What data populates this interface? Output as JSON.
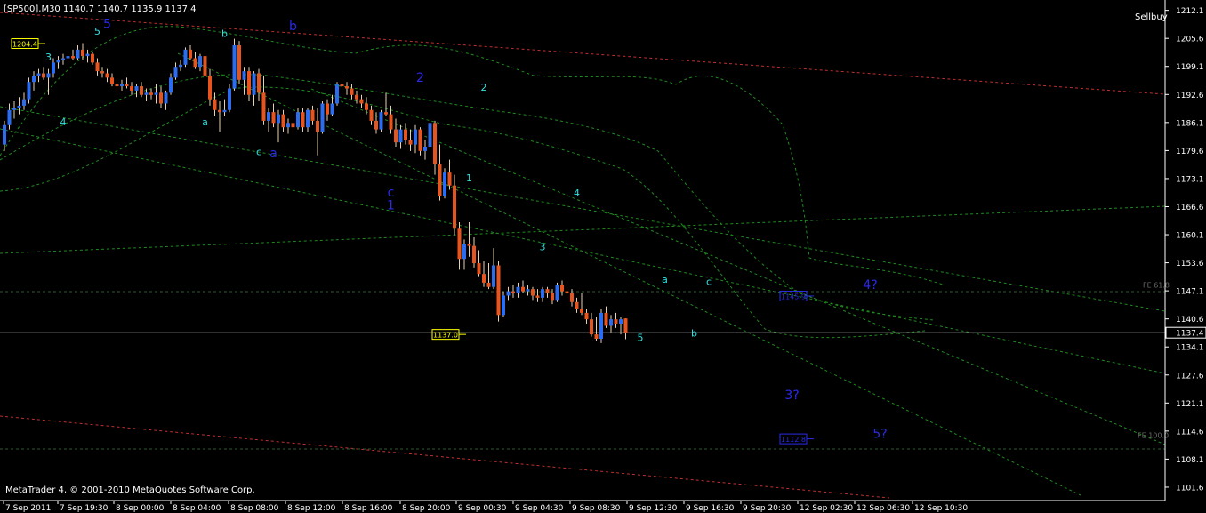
{
  "header": {
    "symbol_info": "[SP500],M30  1140.7 1140.7 1135.9 1137.4",
    "expert_name": "Sellbuy",
    "copyright": "MetaTrader 4, © 2001-2010 MetaQuotes Software Corp."
  },
  "colors": {
    "background": "#000000",
    "bull_candle": "#2b6cf0",
    "bear_candle": "#e8541e",
    "wick": "#e8d0b0",
    "bid_line": "#c8c8c8",
    "axis_text": "#ffffff",
    "indicator": "#1f8a1f",
    "channel_red": "#c03030",
    "wave_cyan": "#30e0e0",
    "wave_blue": "#2a2ae8",
    "price_tag": "#ffff00"
  },
  "chart_data": {
    "type": "candlestick",
    "symbol": "SP500",
    "timeframe": "M30",
    "ylim": [
      1098.5,
      1214.5
    ],
    "y_ticks": [
      "1212.1",
      "1205.6",
      "1199.1",
      "1192.6",
      "1186.1",
      "1179.6",
      "1173.1",
      "1166.6",
      "1160.1",
      "1153.6",
      "1147.1",
      "1140.6",
      "1134.1",
      "1127.6",
      "1121.1",
      "1114.6",
      "1108.1",
      "1101.6"
    ],
    "x_ticks": [
      "7 Sep 2011",
      "7 Sep 19:30",
      "8 Sep 00:00",
      "8 Sep 04:00",
      "8 Sep 08:00",
      "8 Sep 12:00",
      "8 Sep 16:00",
      "8 Sep 20:00",
      "9 Sep 00:30",
      "9 Sep 04:30",
      "9 Sep 08:30",
      "9 Sep 12:30",
      "9 Sep 16:30",
      "9 Sep 20:30",
      "12 Sep 02:30",
      "12 Sep 06:30",
      "12 Sep 10:30"
    ],
    "current_price": "1137.4",
    "tags": [
      {
        "label": "1204.4",
        "price": 1204.4,
        "bar": 4
      },
      {
        "label": "1137.0",
        "price": 1137.0,
        "bar": 90
      },
      {
        "label": "1145.9",
        "price": 1145.9,
        "bar": 152
      },
      {
        "label": "1112.8",
        "price": 1112.8,
        "bar": 152
      }
    ],
    "fe_levels": [
      {
        "label": "FE 61.8",
        "price": 1147.6
      },
      {
        "label": "FE 100.0",
        "price": 1112.8
      }
    ],
    "series": [
      {
        "name": "SP500",
        "ohlc": [
          [
            1181.0,
            1186.5,
            1179.5,
            1185.5
          ],
          [
            1185.5,
            1190.5,
            1184.5,
            1189.0
          ],
          [
            1189.0,
            1191.0,
            1187.0,
            1189.5
          ],
          [
            1189.5,
            1192.0,
            1188.0,
            1190.0
          ],
          [
            1190.0,
            1193.0,
            1189.0,
            1191.5
          ],
          [
            1191.5,
            1196.5,
            1190.5,
            1195.5
          ],
          [
            1195.5,
            1198.0,
            1193.5,
            1197.0
          ],
          [
            1197.0,
            1198.5,
            1195.5,
            1197.5
          ],
          [
            1197.5,
            1199.0,
            1196.0,
            1196.5
          ],
          [
            1196.5,
            1198.5,
            1192.5,
            1197.5
          ],
          [
            1197.5,
            1201.0,
            1196.5,
            1200.0
          ],
          [
            1200.0,
            1201.5,
            1198.5,
            1200.5
          ],
          [
            1200.5,
            1202.0,
            1199.5,
            1201.0
          ],
          [
            1201.0,
            1202.5,
            1200.0,
            1201.5
          ],
          [
            1201.5,
            1203.0,
            1200.5,
            1201.0
          ],
          [
            1201.0,
            1204.0,
            1200.5,
            1203.0
          ],
          [
            1203.0,
            1204.5,
            1200.5,
            1201.5
          ],
          [
            1201.5,
            1203.0,
            1200.0,
            1202.0
          ],
          [
            1202.0,
            1202.5,
            1199.5,
            1200.0
          ],
          [
            1200.0,
            1201.0,
            1197.0,
            1198.0
          ],
          [
            1198.0,
            1199.0,
            1196.5,
            1197.5
          ],
          [
            1197.5,
            1198.5,
            1195.5,
            1196.5
          ],
          [
            1196.5,
            1197.5,
            1194.5,
            1195.0
          ],
          [
            1195.0,
            1196.0,
            1193.0,
            1194.5
          ],
          [
            1194.5,
            1196.0,
            1193.5,
            1195.0
          ],
          [
            1195.0,
            1196.5,
            1194.0,
            1194.5
          ],
          [
            1194.5,
            1195.5,
            1192.5,
            1193.5
          ],
          [
            1193.5,
            1195.0,
            1192.0,
            1194.5
          ],
          [
            1194.5,
            1195.5,
            1192.0,
            1192.5
          ],
          [
            1192.5,
            1194.0,
            1191.0,
            1193.0
          ],
          [
            1193.0,
            1194.0,
            1191.5,
            1192.5
          ],
          [
            1192.5,
            1195.0,
            1190.5,
            1193.0
          ],
          [
            1193.0,
            1194.5,
            1189.5,
            1190.5
          ],
          [
            1190.5,
            1193.5,
            1189.0,
            1193.0
          ],
          [
            1193.0,
            1197.5,
            1192.5,
            1196.5
          ],
          [
            1196.5,
            1200.0,
            1196.0,
            1199.0
          ],
          [
            1199.0,
            1200.5,
            1198.0,
            1199.5
          ],
          [
            1199.5,
            1203.5,
            1199.0,
            1203.0
          ],
          [
            1203.0,
            1204.0,
            1200.5,
            1201.0
          ],
          [
            1201.0,
            1202.5,
            1198.5,
            1199.0
          ],
          [
            1199.0,
            1202.0,
            1198.0,
            1201.5
          ],
          [
            1201.5,
            1202.5,
            1196.5,
            1197.0
          ],
          [
            1197.0,
            1198.5,
            1190.0,
            1191.5
          ],
          [
            1191.5,
            1193.0,
            1187.5,
            1189.0
          ],
          [
            1189.0,
            1191.0,
            1184.0,
            1188.5
          ],
          [
            1188.5,
            1191.5,
            1187.5,
            1189.0
          ],
          [
            1189.0,
            1195.0,
            1188.5,
            1194.0
          ],
          [
            1194.0,
            1205.5,
            1193.5,
            1204.0
          ],
          [
            1204.0,
            1205.0,
            1195.0,
            1196.0
          ],
          [
            1196.0,
            1199.0,
            1192.5,
            1198.0
          ],
          [
            1198.0,
            1199.0,
            1191.0,
            1192.5
          ],
          [
            1192.5,
            1198.0,
            1190.0,
            1197.5
          ],
          [
            1197.5,
            1198.5,
            1191.0,
            1193.0
          ],
          [
            1193.0,
            1197.0,
            1185.5,
            1186.5
          ],
          [
            1186.5,
            1189.5,
            1184.0,
            1188.5
          ],
          [
            1188.5,
            1190.5,
            1185.0,
            1186.0
          ],
          [
            1186.0,
            1189.0,
            1181.5,
            1188.0
          ],
          [
            1188.0,
            1189.0,
            1184.0,
            1185.0
          ],
          [
            1185.0,
            1187.0,
            1183.5,
            1186.0
          ],
          [
            1186.0,
            1187.5,
            1184.0,
            1185.0
          ],
          [
            1185.0,
            1189.5,
            1184.5,
            1188.5
          ],
          [
            1188.5,
            1189.5,
            1184.0,
            1185.0
          ],
          [
            1185.0,
            1189.5,
            1184.0,
            1189.0
          ],
          [
            1189.0,
            1190.0,
            1185.5,
            1186.5
          ],
          [
            1186.5,
            1189.5,
            1178.5,
            1184.0
          ],
          [
            1184.0,
            1191.0,
            1183.5,
            1190.5
          ],
          [
            1190.5,
            1191.5,
            1186.5,
            1188.0
          ],
          [
            1188.0,
            1192.5,
            1187.5,
            1190.5
          ],
          [
            1190.5,
            1195.5,
            1190.0,
            1195.0
          ],
          [
            1195.0,
            1196.5,
            1193.5,
            1194.5
          ],
          [
            1194.5,
            1195.5,
            1192.5,
            1194.0
          ],
          [
            1194.0,
            1195.0,
            1191.5,
            1192.5
          ],
          [
            1192.5,
            1193.5,
            1190.5,
            1191.5
          ],
          [
            1191.5,
            1192.5,
            1189.5,
            1190.5
          ],
          [
            1190.5,
            1192.0,
            1188.0,
            1189.0
          ],
          [
            1189.0,
            1190.0,
            1185.5,
            1186.5
          ],
          [
            1186.5,
            1188.5,
            1183.5,
            1184.5
          ],
          [
            1184.5,
            1189.0,
            1184.0,
            1188.5
          ],
          [
            1188.5,
            1193.0,
            1187.5,
            1188.0
          ],
          [
            1188.0,
            1190.0,
            1183.5,
            1184.5
          ],
          [
            1184.5,
            1187.0,
            1180.5,
            1181.5
          ],
          [
            1181.5,
            1185.5,
            1180.0,
            1184.5
          ],
          [
            1184.5,
            1186.0,
            1181.0,
            1182.0
          ],
          [
            1182.0,
            1184.5,
            1179.5,
            1181.0
          ],
          [
            1181.0,
            1185.5,
            1179.0,
            1184.5
          ],
          [
            1184.5,
            1185.0,
            1178.5,
            1179.5
          ],
          [
            1179.5,
            1182.0,
            1177.5,
            1180.5
          ],
          [
            1180.5,
            1187.0,
            1180.0,
            1186.0
          ],
          [
            1186.0,
            1186.5,
            1174.0,
            1176.5
          ],
          [
            1176.5,
            1181.0,
            1168.0,
            1169.0
          ],
          [
            1169.0,
            1175.5,
            1168.5,
            1174.5
          ],
          [
            1174.5,
            1177.5,
            1170.5,
            1171.5
          ],
          [
            1171.5,
            1174.0,
            1160.0,
            1161.5
          ],
          [
            1161.5,
            1163.0,
            1152.0,
            1154.5
          ],
          [
            1154.5,
            1159.0,
            1152.0,
            1158.0
          ],
          [
            1158.0,
            1163.0,
            1155.0,
            1157.5
          ],
          [
            1157.5,
            1159.5,
            1152.5,
            1153.5
          ],
          [
            1153.5,
            1156.5,
            1150.5,
            1151.0
          ],
          [
            1151.0,
            1154.0,
            1148.0,
            1149.0
          ],
          [
            1149.0,
            1153.5,
            1147.5,
            1148.0
          ],
          [
            1148.0,
            1157.0,
            1147.5,
            1153.0
          ],
          [
            1153.0,
            1154.0,
            1140.0,
            1141.5
          ],
          [
            1141.5,
            1147.0,
            1141.0,
            1146.0
          ],
          [
            1146.0,
            1148.0,
            1145.0,
            1147.0
          ],
          [
            1147.0,
            1148.5,
            1145.5,
            1146.5
          ],
          [
            1146.5,
            1149.0,
            1145.5,
            1148.0
          ],
          [
            1148.0,
            1149.5,
            1146.5,
            1147.0
          ],
          [
            1147.0,
            1148.5,
            1146.0,
            1147.5
          ],
          [
            1147.5,
            1148.0,
            1145.0,
            1146.0
          ],
          [
            1146.0,
            1147.5,
            1144.5,
            1145.5
          ],
          [
            1145.5,
            1148.0,
            1144.5,
            1147.5
          ],
          [
            1147.5,
            1148.0,
            1145.5,
            1146.5
          ],
          [
            1146.5,
            1147.5,
            1144.0,
            1145.0
          ],
          [
            1145.0,
            1149.0,
            1144.5,
            1148.5
          ],
          [
            1148.5,
            1149.5,
            1146.0,
            1147.0
          ],
          [
            1147.0,
            1148.0,
            1145.5,
            1146.5
          ],
          [
            1146.5,
            1147.5,
            1143.5,
            1144.5
          ],
          [
            1144.5,
            1145.5,
            1142.0,
            1143.0
          ],
          [
            1143.0,
            1146.5,
            1141.5,
            1142.0
          ],
          [
            1142.0,
            1143.0,
            1139.5,
            1140.5
          ],
          [
            1140.5,
            1142.0,
            1136.5,
            1137.0
          ],
          [
            1137.0,
            1141.0,
            1135.5,
            1136.0
          ],
          [
            1136.0,
            1143.0,
            1135.0,
            1142.0
          ],
          [
            1142.0,
            1143.5,
            1138.5,
            1139.0
          ],
          [
            1139.0,
            1141.5,
            1137.5,
            1140.5
          ],
          [
            1140.5,
            1142.0,
            1138.5,
            1139.5
          ],
          [
            1139.5,
            1141.0,
            1137.0,
            1140.5
          ],
          [
            1140.7,
            1140.7,
            1135.9,
            1137.4
          ]
        ]
      }
    ]
  },
  "wave_labels": [
    {
      "text": "3",
      "bar": 9,
      "price": 1200.5,
      "color": "cyan",
      "big": false
    },
    {
      "text": "4",
      "bar": 12,
      "price": 1185.5,
      "color": "cyan",
      "big": false
    },
    {
      "text": "5",
      "bar": 19,
      "price": 1206.5,
      "color": "cyan",
      "big": false
    },
    {
      "text": "5",
      "bar": 21,
      "price": 1208.0,
      "color": "blue",
      "big": true
    },
    {
      "text": "a",
      "bar": 41,
      "price": 1185.5,
      "color": "cyan",
      "big": false
    },
    {
      "text": "b",
      "bar": 45,
      "price": 1206.0,
      "color": "cyan",
      "big": false
    },
    {
      "text": "c",
      "bar": 52,
      "price": 1178.5,
      "color": "cyan",
      "big": false
    },
    {
      "text": "a",
      "bar": 55,
      "price": 1178.0,
      "color": "blue",
      "big": true
    },
    {
      "text": "b",
      "bar": 59,
      "price": 1207.5,
      "color": "blue",
      "big": true
    },
    {
      "text": "c",
      "bar": 79,
      "price": 1169.0,
      "color": "blue",
      "big": true
    },
    {
      "text": "1",
      "bar": 79,
      "price": 1166.0,
      "color": "blue",
      "big": true
    },
    {
      "text": "2",
      "bar": 85,
      "price": 1195.5,
      "color": "blue",
      "big": true
    },
    {
      "text": "1",
      "bar": 95,
      "price": 1172.5,
      "color": "cyan",
      "big": false
    },
    {
      "text": "2",
      "bar": 98,
      "price": 1193.5,
      "color": "cyan",
      "big": false
    },
    {
      "text": "3",
      "bar": 110,
      "price": 1156.5,
      "color": "cyan",
      "big": false
    },
    {
      "text": "4",
      "bar": 117,
      "price": 1169.0,
      "color": "cyan",
      "big": false
    },
    {
      "text": "5",
      "bar": 130,
      "price": 1135.5,
      "color": "cyan",
      "big": false
    },
    {
      "text": "a",
      "bar": 135,
      "price": 1149.0,
      "color": "cyan",
      "big": false
    },
    {
      "text": "b",
      "bar": 141,
      "price": 1136.5,
      "color": "cyan",
      "big": false
    },
    {
      "text": "c",
      "bar": 144,
      "price": 1148.5,
      "color": "cyan",
      "big": false
    },
    {
      "text": "4?",
      "bar": 177,
      "price": 1147.5,
      "color": "blue",
      "big": true
    },
    {
      "text": "3?",
      "bar": 161,
      "price": 1122.0,
      "color": "blue",
      "big": true
    },
    {
      "text": "5?",
      "bar": 179,
      "price": 1113.0,
      "color": "blue",
      "big": true
    }
  ]
}
